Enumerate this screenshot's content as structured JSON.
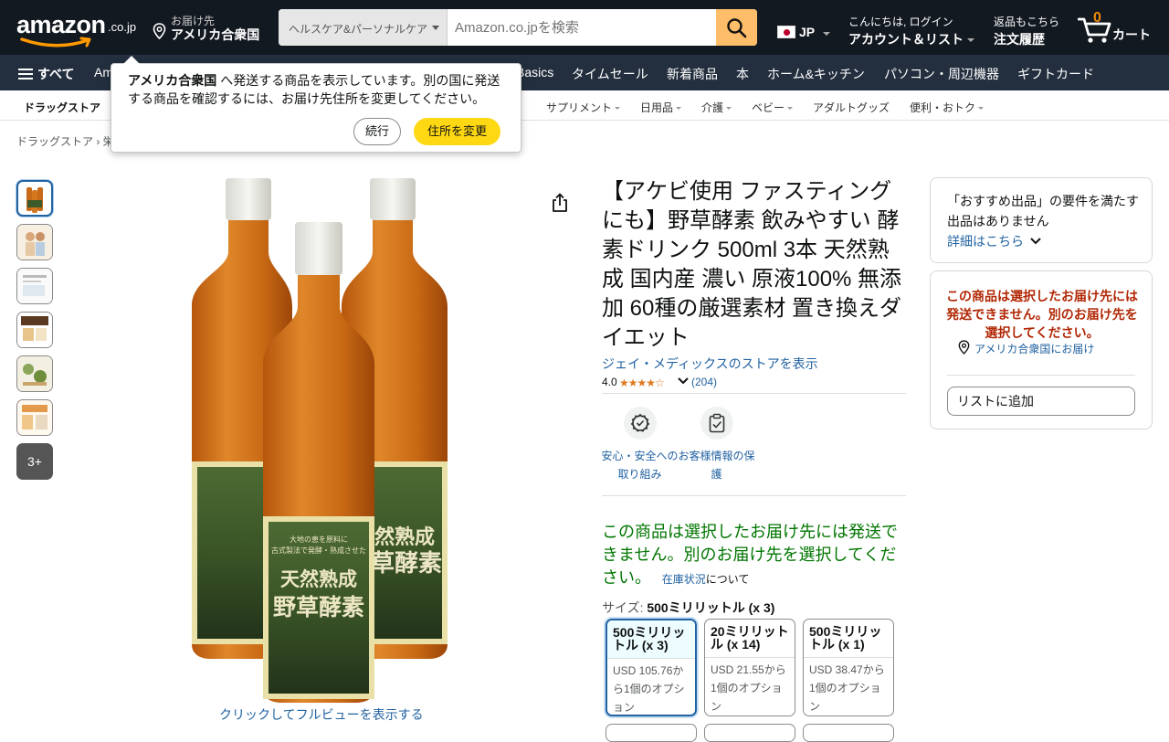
{
  "header": {
    "logo_text": "amazon",
    "logo_tld": ".co.jp",
    "deliver_label": "お届け先",
    "deliver_country": "アメリカ合衆国",
    "search_category": "ヘルスケア&パーソナルケア",
    "search_placeholder": "Amazon.co.jpを検索",
    "language": "JP",
    "greeting": "こんにちは, ログイン",
    "account_label": "アカウント＆リスト",
    "returns_label": "返品もこちら",
    "orders_label": "注文履歴",
    "cart_count": "0",
    "cart_label": "カート"
  },
  "navbar": {
    "all_label": "すべて",
    "items": [
      "Am",
      "Basics",
      "タイムセール",
      "新着商品",
      "本",
      "ホーム&キッチン",
      "パソコン・周辺機器",
      "ギフトカード"
    ]
  },
  "subnav": {
    "first": "ドラッグストア",
    "items": [
      "サプリメント",
      "日用品",
      "介護",
      "ベビー",
      "アダルトグッズ",
      "便利・おトク"
    ]
  },
  "breadcrumb": "ドラッグストア › 栄",
  "popover": {
    "country": "アメリカ合衆国",
    "message": " へ発送する商品を表示しています。別の国に発送する商品を確認するには、お届け先住所を変更してください。",
    "continue_label": "続行",
    "change_label": "住所を変更"
  },
  "gallery": {
    "more_label": "3+",
    "full_view_label": "クリックしてフルビューを表示する"
  },
  "product": {
    "title": "【アケビ使用 ファスティングにも】野草酵素 飲みやすい 酵素ドリンク 500ml 3本 天然熟成 国内産 濃い 原液100% 無添加 60種の厳選素材 置き換えダイエット",
    "store_link": "ジェイ・メディックスのストアを表示",
    "rating_value": "4.0",
    "stars": "★★★★☆",
    "rating_count": "(204)",
    "label_line1": "大地の恵を原料に",
    "label_line2": "古式製法で発酵・熟成させた",
    "label_big1": "天然熟成",
    "label_big2": "野草酵素",
    "badges": [
      {
        "icon": "safety-badge-icon",
        "label": "安心・安全への取り組み"
      },
      {
        "icon": "clipboard-check-icon",
        "label": "お客様情報の保護"
      }
    ],
    "unavailable_message": "この商品は選択したお届け先には発送できません。別のお届け先を選択してください。",
    "stock_link": "在庫状況",
    "stock_suffix": "について",
    "size_label": "サイズ: ",
    "size_value": "500ミリリットル (x 3)",
    "options": [
      {
        "name": "500ミリリットル (x 3)",
        "price": "USD 105.76から1個のオプション",
        "selected": true
      },
      {
        "name": "20ミリリットル (x 14)",
        "price": "USD 21.55から1個のオプション",
        "selected": false
      },
      {
        "name": "500ミリリットル (x 1)",
        "price": "USD 38.47から1個のオプション",
        "selected": false
      }
    ]
  },
  "buybox": {
    "recommend_text": "「おすすめ出品」の要件を満たす出品はありません",
    "details_link": "詳細はこちら",
    "warning": "この商品は選択したお届け先には発送できません。別のお届け先を選択してください。",
    "deliver_to": "アメリカ合衆国にお届け",
    "add_to_list": "リストに追加"
  },
  "colors": {
    "topbar": "#131921",
    "navbar": "#232f3e",
    "search_button": "#febd69",
    "link": "#2162a1",
    "success": "#007600",
    "warning": "#b12704",
    "primary_button": "#ffd814",
    "star": "#de7921"
  }
}
